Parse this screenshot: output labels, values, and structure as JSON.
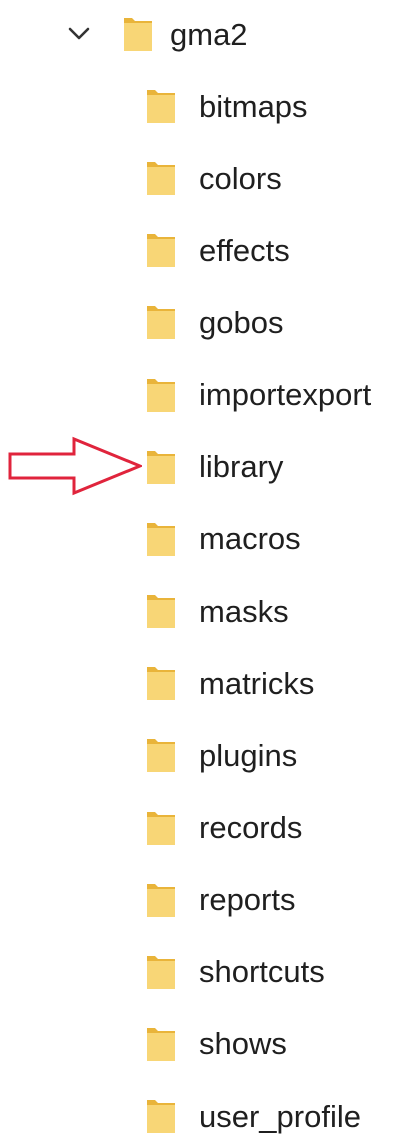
{
  "tree": {
    "root": {
      "label": "gma2",
      "expanded": true,
      "chevron_icon": "chevron-down-icon",
      "folder_icon": "folder-icon"
    },
    "children": [
      {
        "label": "bitmaps"
      },
      {
        "label": "colors"
      },
      {
        "label": "effects"
      },
      {
        "label": "gobos"
      },
      {
        "label": "importexport"
      },
      {
        "label": "library"
      },
      {
        "label": "macros"
      },
      {
        "label": "masks"
      },
      {
        "label": "matricks"
      },
      {
        "label": "plugins"
      },
      {
        "label": "records"
      },
      {
        "label": "reports"
      },
      {
        "label": "shortcuts"
      },
      {
        "label": "shows"
      },
      {
        "label": "user_profile"
      }
    ]
  },
  "annotation": {
    "type": "arrow-outline",
    "points_to": "library",
    "color": "#e0243c"
  },
  "colors": {
    "folder_front": "#f8d676",
    "folder_back": "#e9b43a",
    "text": "#1f1f1f",
    "chevron": "#333333"
  }
}
